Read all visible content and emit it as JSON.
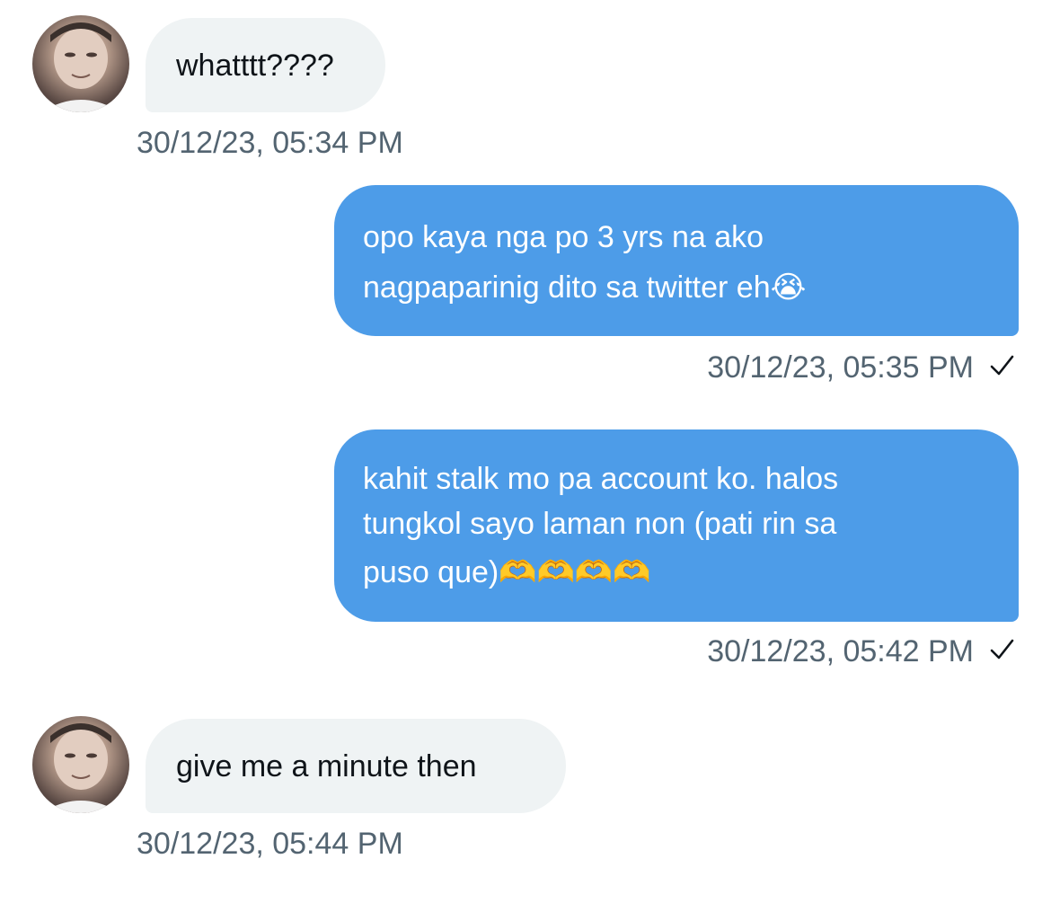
{
  "messages": [
    {
      "direction": "incoming",
      "text": "whatttt????",
      "timestamp": "30/12/23, 05:34 PM"
    },
    {
      "direction": "outgoing",
      "line1": "opo kaya nga po 3 yrs na ako",
      "line2": "nagpaparinig dito sa twitter eh😭",
      "timestamp": "30/12/23, 05:35 PM"
    },
    {
      "direction": "outgoing",
      "line1": "kahit stalk mo pa account ko. halos",
      "line2": "tungkol sayo laman non (pati rin sa",
      "line3": "puso que)🫶🫶🫶🫶",
      "timestamp": "30/12/23, 05:42 PM"
    },
    {
      "direction": "incoming",
      "text": "give me a minute then",
      "timestamp": "30/12/23, 05:44 PM"
    }
  ],
  "colors": {
    "incoming_bubble": "#eff3f4",
    "outgoing_bubble": "#4d9ce8",
    "timestamp": "#536471"
  },
  "icons": {
    "sent": "checkmark-icon",
    "avatar": "avatar"
  }
}
